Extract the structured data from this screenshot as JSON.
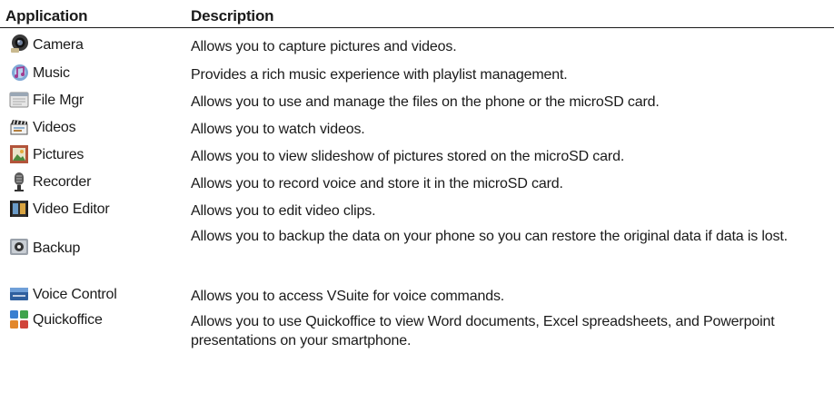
{
  "header": {
    "application": "Application",
    "description": "Description"
  },
  "rows": [
    {
      "icon": "camera-icon",
      "name": "Camera",
      "description": "Allows you to capture pictures and videos."
    },
    {
      "icon": "music-icon",
      "name": "Music",
      "description": "Provides a rich music experience with playlist management."
    },
    {
      "icon": "file-manager-icon",
      "name": "File Mgr",
      "description": "Allows you to use and manage the files on the phone or the microSD card."
    },
    {
      "icon": "videos-icon",
      "name": "Videos",
      "description": "Allows you to watch videos."
    },
    {
      "icon": "pictures-icon",
      "name": "Pictures",
      "description": "Allows you to view slideshow of pictures stored on the microSD card."
    },
    {
      "icon": "recorder-icon",
      "name": "Recorder",
      "description": "Allows you to record voice and store it in the microSD card."
    },
    {
      "icon": "video-editor-icon",
      "name": "Video Editor",
      "description": "Allows you to edit video clips."
    },
    {
      "icon": "backup-icon",
      "name": "Backup",
      "description": "Allows you to backup the data on your phone so you can restore the original data if data is lost."
    },
    {
      "icon": "voice-control-icon",
      "name": "Voice Control",
      "description": "Allows you to access VSuite for voice commands."
    },
    {
      "icon": "quickoffice-icon",
      "name": "Quickoffice",
      "description": "Allows you to use Quickoffice to view Word documents, Excel spreadsheets, and Powerpoint presentations on your smartphone."
    }
  ]
}
